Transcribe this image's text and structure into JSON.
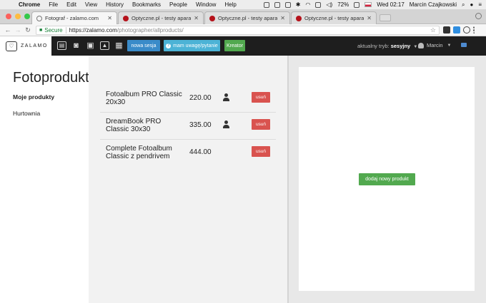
{
  "menubar": {
    "items": [
      "Chrome",
      "File",
      "Edit",
      "View",
      "History",
      "Bookmarks",
      "People",
      "Window",
      "Help"
    ],
    "battery": "72%",
    "clock": "Wed 02:17",
    "user": "Marcin Czajkowski"
  },
  "tabs": [
    {
      "title": "Fotograf - zalamo.com",
      "active": true
    },
    {
      "title": "Optyczne.pl - testy aparató...",
      "active": false
    },
    {
      "title": "Optyczne.pl - testy aparató...",
      "active": false
    },
    {
      "title": "Optyczne.pl - testy aparató...",
      "active": false
    }
  ],
  "address": {
    "secure_label": "Secure",
    "url_host": "https://zalamo.com",
    "url_path": "/photographer/allproducts/"
  },
  "appnav": {
    "logo_text": "ZALAMO",
    "new_session": "nowa sesja",
    "question": "mam uwagę/pytanie",
    "creator": "Kreator",
    "mode_label": "aktualny tryb:",
    "mode_value": "sesyjny",
    "user_name": "Marcin"
  },
  "sidebar": {
    "title": "Fotoprodukty",
    "links": [
      "Moje produkty",
      "Hurtownia"
    ]
  },
  "products": [
    {
      "name": "Fotoalbum PRO Classic 20x30",
      "price": "220.00",
      "delete_label": "usuń"
    },
    {
      "name": "DreamBook PRO Classic 30x30",
      "price": "335.00",
      "delete_label": "usuń"
    },
    {
      "name": "Complete Fotoalbum Classic z pendrivem",
      "price": "444.00",
      "delete_label": "usuń"
    }
  ],
  "right": {
    "add_product": "dodaj nowy produkt"
  },
  "colors": {
    "danger": "#d9534f",
    "success": "#52a94f",
    "primary": "#3a8bc9",
    "info": "#4cb3d6",
    "nav_bg": "#1e1e1e"
  }
}
